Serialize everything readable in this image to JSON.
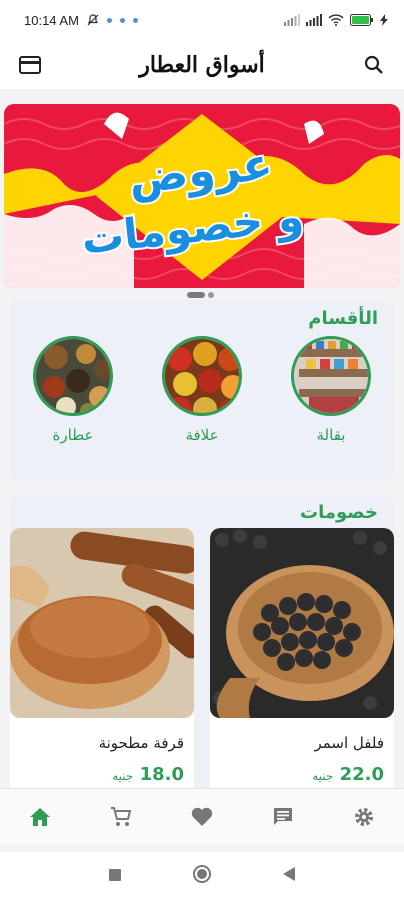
{
  "status_bar": {
    "time": "10:14 AM"
  },
  "app_bar": {
    "title": "أسواق العطار"
  },
  "banner": {
    "line1": "عروض",
    "line2": "و خصومات"
  },
  "categories": {
    "title": "الأقسام",
    "items": [
      {
        "label": "بقالة"
      },
      {
        "label": "علافة"
      },
      {
        "label": "عطارة"
      }
    ]
  },
  "discounts": {
    "title": "خصومات",
    "products": [
      {
        "name": "فلفل اسمر",
        "price": "22.0",
        "currency": "جنيه"
      },
      {
        "name": "قرفة مطحونة",
        "price": "18.0",
        "currency": "جنيه"
      }
    ]
  },
  "colors": {
    "accent": "#2f9d57",
    "banner_red": "#e8193c",
    "banner_yellow": "#ffd400",
    "banner_text": "#1a8fe0"
  },
  "bottom_nav": [
    "home-icon",
    "cart-icon",
    "heart-icon",
    "chat-icon",
    "settings-icon"
  ]
}
